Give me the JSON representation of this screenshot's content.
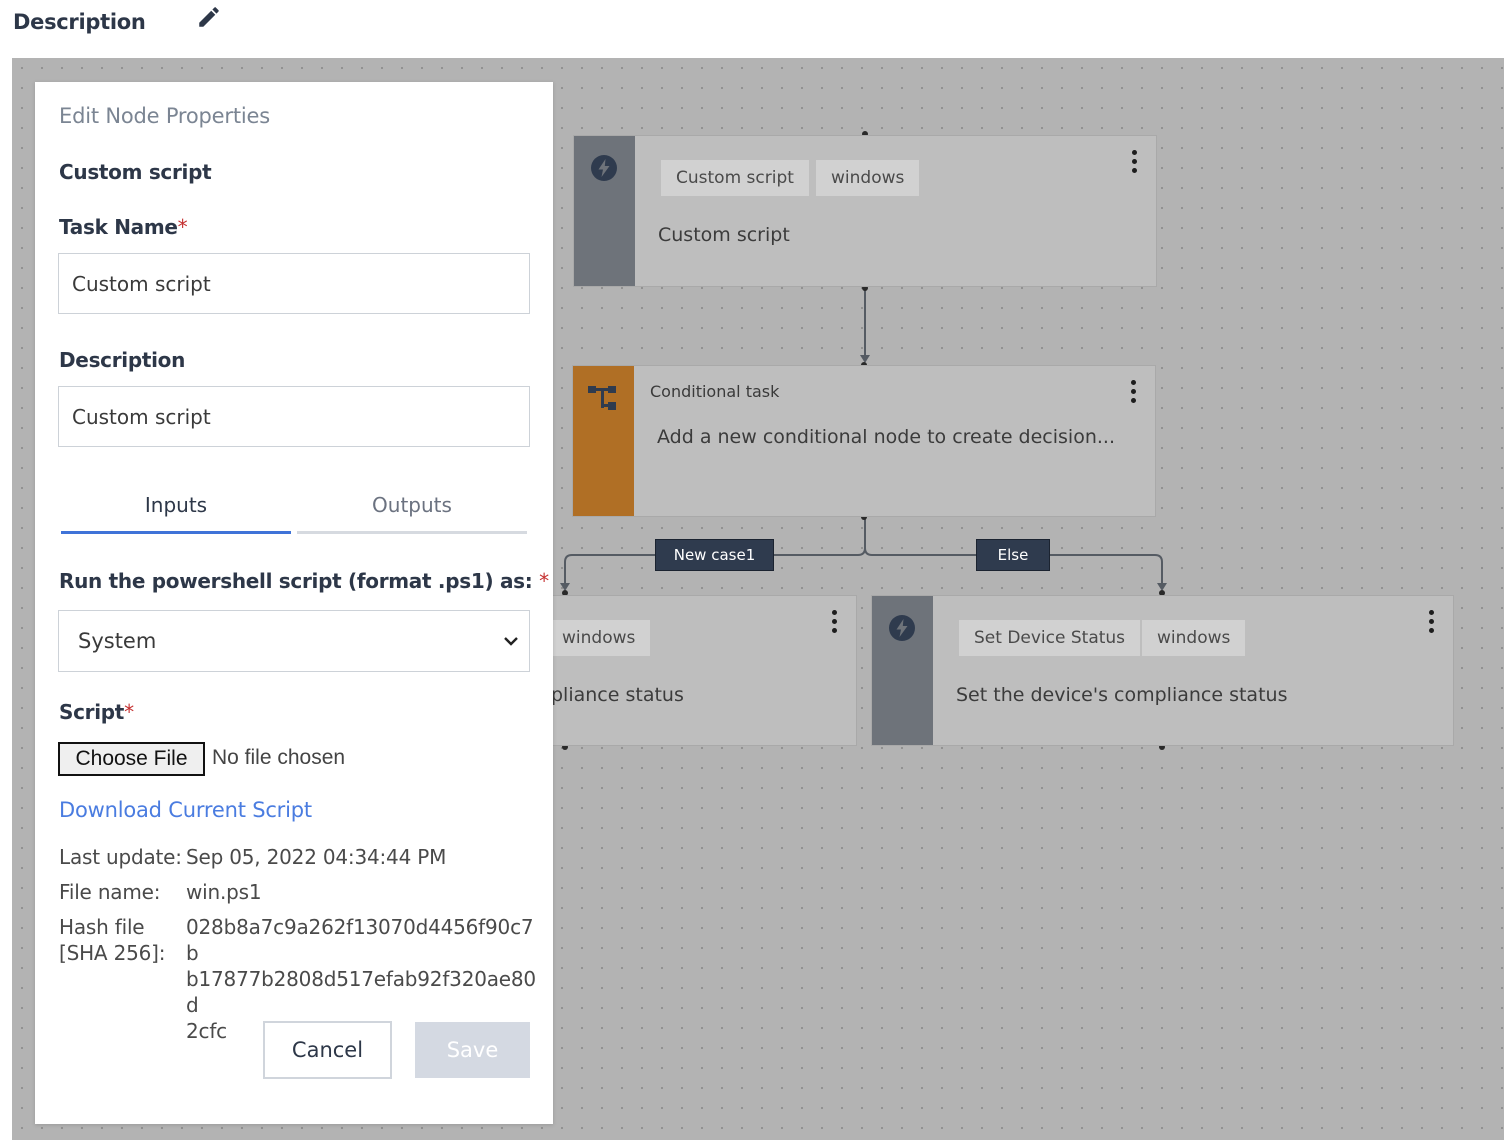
{
  "header": {
    "title": "Description",
    "edit_icon": "pencil-icon"
  },
  "flow": {
    "top_node": {
      "tags": [
        "Custom script",
        "windows"
      ],
      "description": "Custom script",
      "icon": "bolt-icon"
    },
    "conditional_node": {
      "title": "Conditional task",
      "description": "Add a new conditional node to create decision...",
      "icon": "branch-icon"
    },
    "edges": {
      "case_label": "New case1",
      "else_label": "Else"
    },
    "left_node": {
      "tag": "windows",
      "description_visible": "pliance status"
    },
    "right_node": {
      "tags": [
        "Set Device Status",
        "windows"
      ],
      "description": "Set the device's compliance status",
      "icon": "bolt-icon"
    }
  },
  "panel": {
    "heading": "Edit Node Properties",
    "node_type": "Custom script",
    "task_name": {
      "label": "Task Name",
      "required_mark": "*",
      "value": "Custom script"
    },
    "description": {
      "label": "Description",
      "value": "Custom script"
    },
    "tabs": {
      "inputs": "Inputs",
      "outputs": "Outputs",
      "active": "Inputs"
    },
    "run_as": {
      "label": "Run the powershell script (format .ps1) as: ",
      "required_mark": "*",
      "selected": "System"
    },
    "script": {
      "label": "Script",
      "required_mark": "*",
      "choose_button": "Choose File",
      "no_file": "No file chosen",
      "download_link": "Download Current Script"
    },
    "meta": {
      "last_update_label": "Last update:",
      "last_update_value": "Sep 05, 2022 04:34:44 PM",
      "file_name_label": "File name:",
      "file_name_value": "win.ps1",
      "hash_label_1": "Hash file",
      "hash_label_2": "[SHA 256]:",
      "hash_line_1": "028b8a7c9a262f13070d4456f90c7b",
      "hash_line_2": "b17877b2808d517efab92f320ae80d",
      "hash_line_3": "2cfc"
    },
    "buttons": {
      "cancel": "Cancel",
      "save": "Save"
    }
  },
  "colors": {
    "accent": "#3f73d8",
    "conditional": "#b06f25",
    "edge_label": "#2f3b4e",
    "required": "#c53030"
  }
}
